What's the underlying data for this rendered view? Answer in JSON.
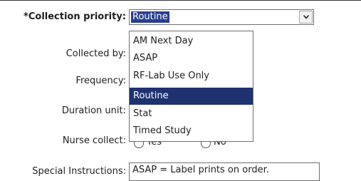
{
  "form": {
    "collection_priority_label": "*Collection priority:",
    "collected_by_label": "Collected by:",
    "frequency_label": "Frequency:",
    "duration_unit_label": "Duration unit:",
    "nurse_collect_label": "Nurse collect:",
    "special_instructions_label": "Special Instructions:"
  },
  "priority_select": {
    "value": "Routine",
    "options": [
      "AM Next Day",
      "ASAP",
      "RF-Lab Use Only",
      "Routine",
      "Stat",
      "Timed Study"
    ],
    "selected_option": "Routine"
  },
  "nurse_collect": {
    "yes_label": "Yes",
    "no_label": "No"
  },
  "special_instructions": {
    "value": "ASAP = Label prints on order."
  },
  "colors": {
    "selection_highlight": "#1f3270",
    "value_highlight": "#2b3f8f"
  }
}
